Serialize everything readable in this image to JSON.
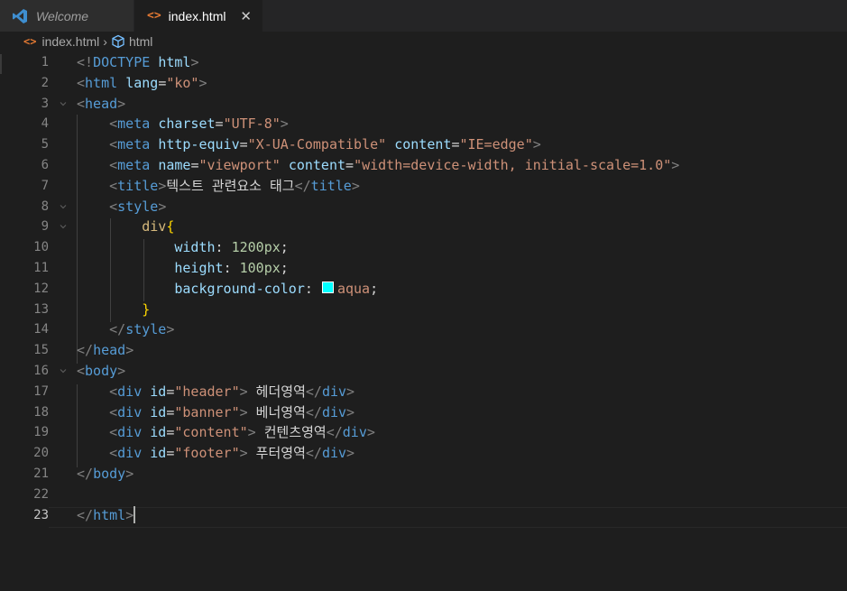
{
  "tabs": [
    {
      "label": "Welcome",
      "icon": "vscode-logo-icon"
    },
    {
      "label": "index.html",
      "icon": "html-file-icon",
      "close": "✕"
    }
  ],
  "breadcrumb": {
    "file": "index.html",
    "separator": "›",
    "symbol": "html"
  },
  "colors": {
    "swatch": "#00ffff",
    "accent": "#e37933"
  },
  "editor": {
    "active_line": "23",
    "lines": [
      {
        "num": "1",
        "segs": [
          [
            "tg",
            "<!"
          ],
          [
            "tn",
            "DOCTYPE"
          ],
          [
            "tx",
            " "
          ],
          [
            "an",
            "html"
          ],
          [
            "tg",
            ">"
          ]
        ]
      },
      {
        "num": "2",
        "segs": [
          [
            "tg",
            "<"
          ],
          [
            "tn",
            "html"
          ],
          [
            "tx",
            " "
          ],
          [
            "an",
            "lang"
          ],
          [
            "tx",
            "="
          ],
          [
            "av",
            "\"ko\""
          ],
          [
            "tg",
            ">"
          ]
        ]
      },
      {
        "num": "3",
        "segs": [
          [
            "tg",
            "<"
          ],
          [
            "tn",
            "head"
          ],
          [
            "tg",
            ">"
          ]
        ]
      },
      {
        "num": "4",
        "segs": [
          [
            "tx",
            "    "
          ],
          [
            "tg",
            "<"
          ],
          [
            "tn",
            "meta"
          ],
          [
            "tx",
            " "
          ],
          [
            "an",
            "charset"
          ],
          [
            "tx",
            "="
          ],
          [
            "av",
            "\"UTF-8\""
          ],
          [
            "tg",
            ">"
          ]
        ]
      },
      {
        "num": "5",
        "segs": [
          [
            "tx",
            "    "
          ],
          [
            "tg",
            "<"
          ],
          [
            "tn",
            "meta"
          ],
          [
            "tx",
            " "
          ],
          [
            "an",
            "http-equiv"
          ],
          [
            "tx",
            "="
          ],
          [
            "av",
            "\"X-UA-Compatible\""
          ],
          [
            "tx",
            " "
          ],
          [
            "an",
            "content"
          ],
          [
            "tx",
            "="
          ],
          [
            "av",
            "\"IE=edge\""
          ],
          [
            "tg",
            ">"
          ]
        ]
      },
      {
        "num": "6",
        "segs": [
          [
            "tx",
            "    "
          ],
          [
            "tg",
            "<"
          ],
          [
            "tn",
            "meta"
          ],
          [
            "tx",
            " "
          ],
          [
            "an",
            "name"
          ],
          [
            "tx",
            "="
          ],
          [
            "av",
            "\"viewport\""
          ],
          [
            "tx",
            " "
          ],
          [
            "an",
            "content"
          ],
          [
            "tx",
            "="
          ],
          [
            "av",
            "\"width=device-width, initial-scale=1.0\""
          ],
          [
            "tg",
            ">"
          ]
        ]
      },
      {
        "num": "7",
        "segs": [
          [
            "tx",
            "    "
          ],
          [
            "tg",
            "<"
          ],
          [
            "tn",
            "title"
          ],
          [
            "tg",
            ">"
          ],
          [
            "tx",
            "텍스트 관련요소 태그"
          ],
          [
            "tg",
            "</"
          ],
          [
            "tn",
            "title"
          ],
          [
            "tg",
            ">"
          ]
        ]
      },
      {
        "num": "8",
        "segs": [
          [
            "tx",
            "    "
          ],
          [
            "tg",
            "<"
          ],
          [
            "tn",
            "style"
          ],
          [
            "tg",
            ">"
          ]
        ]
      },
      {
        "num": "9",
        "segs": [
          [
            "tx",
            "        "
          ],
          [
            "sel",
            "div"
          ],
          [
            "br",
            "{"
          ]
        ]
      },
      {
        "num": "10",
        "segs": [
          [
            "tx",
            "            "
          ],
          [
            "pr",
            "width"
          ],
          [
            "tx",
            ": "
          ],
          [
            "nm",
            "1200px"
          ],
          [
            "tx",
            ";"
          ]
        ]
      },
      {
        "num": "11",
        "segs": [
          [
            "tx",
            "            "
          ],
          [
            "pr",
            "height"
          ],
          [
            "tx",
            ": "
          ],
          [
            "nm",
            "100px"
          ],
          [
            "tx",
            ";"
          ]
        ]
      },
      {
        "num": "12",
        "segs": [
          [
            "tx",
            "            "
          ],
          [
            "pr",
            "background-color"
          ],
          [
            "tx",
            ": "
          ],
          [
            "swatch",
            ""
          ],
          [
            "av",
            "aqua"
          ],
          [
            "tx",
            ";"
          ]
        ]
      },
      {
        "num": "13",
        "segs": [
          [
            "tx",
            "        "
          ],
          [
            "br",
            "}"
          ]
        ]
      },
      {
        "num": "14",
        "segs": [
          [
            "tx",
            "    "
          ],
          [
            "tg",
            "</"
          ],
          [
            "tn",
            "style"
          ],
          [
            "tg",
            ">"
          ]
        ]
      },
      {
        "num": "15",
        "segs": [
          [
            "tg",
            "</"
          ],
          [
            "tn",
            "head"
          ],
          [
            "tg",
            ">"
          ]
        ]
      },
      {
        "num": "16",
        "segs": [
          [
            "tg",
            "<"
          ],
          [
            "tn",
            "body"
          ],
          [
            "tg",
            ">"
          ]
        ]
      },
      {
        "num": "17",
        "segs": [
          [
            "tx",
            "    "
          ],
          [
            "tg",
            "<"
          ],
          [
            "tn",
            "div"
          ],
          [
            "tx",
            " "
          ],
          [
            "an",
            "id"
          ],
          [
            "tx",
            "="
          ],
          [
            "av",
            "\"header\""
          ],
          [
            "tg",
            ">"
          ],
          [
            "tx",
            " 헤더영역"
          ],
          [
            "tg",
            "</"
          ],
          [
            "tn",
            "div"
          ],
          [
            "tg",
            ">"
          ]
        ]
      },
      {
        "num": "18",
        "segs": [
          [
            "tx",
            "    "
          ],
          [
            "tg",
            "<"
          ],
          [
            "tn",
            "div"
          ],
          [
            "tx",
            " "
          ],
          [
            "an",
            "id"
          ],
          [
            "tx",
            "="
          ],
          [
            "av",
            "\"banner\""
          ],
          [
            "tg",
            ">"
          ],
          [
            "tx",
            " 베너영역"
          ],
          [
            "tg",
            "</"
          ],
          [
            "tn",
            "div"
          ],
          [
            "tg",
            ">"
          ]
        ]
      },
      {
        "num": "19",
        "segs": [
          [
            "tx",
            "    "
          ],
          [
            "tg",
            "<"
          ],
          [
            "tn",
            "div"
          ],
          [
            "tx",
            " "
          ],
          [
            "an",
            "id"
          ],
          [
            "tx",
            "="
          ],
          [
            "av",
            "\"content\""
          ],
          [
            "tg",
            ">"
          ],
          [
            "tx",
            " 컨텐츠영역"
          ],
          [
            "tg",
            "</"
          ],
          [
            "tn",
            "div"
          ],
          [
            "tg",
            ">"
          ]
        ]
      },
      {
        "num": "20",
        "segs": [
          [
            "tx",
            "    "
          ],
          [
            "tg",
            "<"
          ],
          [
            "tn",
            "div"
          ],
          [
            "tx",
            " "
          ],
          [
            "an",
            "id"
          ],
          [
            "tx",
            "="
          ],
          [
            "av",
            "\"footer\""
          ],
          [
            "tg",
            ">"
          ],
          [
            "tx",
            " 푸터영역"
          ],
          [
            "tg",
            "</"
          ],
          [
            "tn",
            "div"
          ],
          [
            "tg",
            ">"
          ]
        ]
      },
      {
        "num": "21",
        "segs": [
          [
            "tg",
            "</"
          ],
          [
            "tn",
            "body"
          ],
          [
            "tg",
            ">"
          ]
        ]
      },
      {
        "num": "22",
        "segs": []
      },
      {
        "num": "23",
        "segs": [
          [
            "tg",
            "</"
          ],
          [
            "tn",
            "html"
          ],
          [
            "tg",
            ">"
          ],
          [
            "cursor",
            ""
          ]
        ]
      }
    ]
  }
}
